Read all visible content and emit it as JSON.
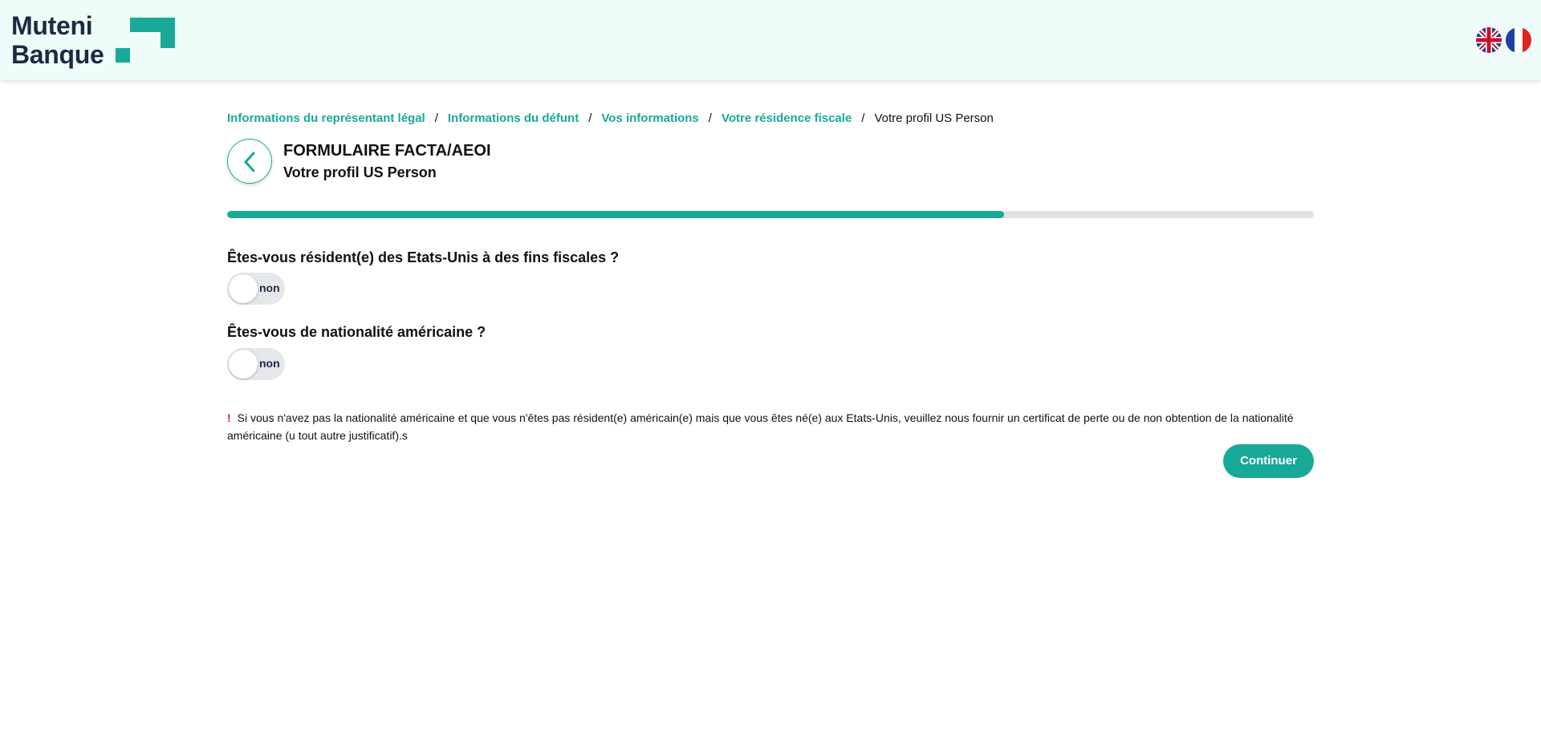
{
  "header": {
    "logo_line1": "Muteni",
    "logo_line2": "Banque",
    "brand_color": "#18a999",
    "languages": [
      "uk-flag-icon",
      "france-flag-icon"
    ]
  },
  "breadcrumb": {
    "items": [
      "Informations du représentant légal",
      "Informations du défunt",
      "Vos informations",
      "Votre résidence fiscale"
    ],
    "separator": "/",
    "current": "Votre profil US Person"
  },
  "form": {
    "title": "FORMULAIRE FACTA/AEOI",
    "subtitle": "Votre profil US Person",
    "progress_percent": 71.5
  },
  "questions": [
    {
      "label": "Êtes-vous résident(e) des Etats-Unis à des fins fiscales ?",
      "toggle_value": "non"
    },
    {
      "label": "Êtes-vous de nationalité américaine ?",
      "toggle_value": "non"
    }
  ],
  "notice": {
    "icon": "!",
    "text": "Si vous n'avez pas la nationalité américaine et que vous n'êtes pas résident(e) américain(e) mais que vous êtes né(e) aux Etats-Unis, veuillez nous fournir un certificat de perte ou de non obtention de la nationalité américaine (u tout autre justificatif).s"
  },
  "actions": {
    "continue_label": "Continuer"
  }
}
